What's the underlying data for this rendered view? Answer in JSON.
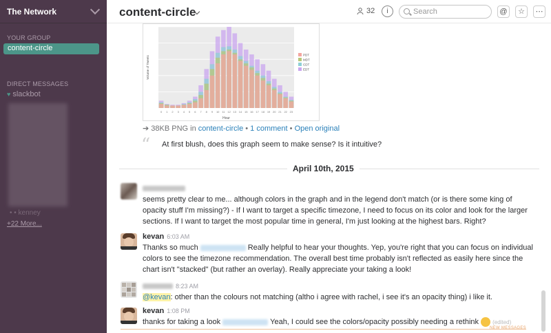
{
  "sidebar": {
    "team_name": "The Network",
    "your_group_title": "YOUR GROUP",
    "active_channel": "content-circle",
    "dm_title": "DIRECT MESSAGES",
    "slackbot": "slackbot",
    "ghost_name": "• • kenney",
    "more_link": "+22 More..."
  },
  "header": {
    "channel_title": "content-circle",
    "member_count": "32",
    "search_placeholder": "Search",
    "info_label": "i",
    "at_label": "@",
    "star_label": "☆",
    "more_label": "⋯"
  },
  "file": {
    "size_type": "38KB PNG in ",
    "channel": "content-circle",
    "comments": "1 comment",
    "open": "Open original",
    "sep": " • "
  },
  "quote_text": "At first blush, does this graph seem to make sense? Is it intuitive?",
  "day_label": "April 10th, 2015",
  "messages": {
    "m1_text": "seems pretty clear to me... although colors in the graph and in the legend don't match (or is there some king of opacity stuff I'm missing?) - If I want to target a specific timezone, I need to focus on its color and look for the larger sections. If I want to target the most popular time in general, I'm just looking at the highest bars. Right?",
    "m2_author": "kevan",
    "m2_time": "6:03 AM",
    "m2_pre": "Thanks so much",
    "m2_post": "Really helpful to hear your thoughts. Yep, you're right that you can focus on individual colors to see the timezone recommendation. The overall best time probably isn't reflected as easily here since the chart isn't \"stacked\" (but rather an overlay). Really appreciate your taking a look!",
    "m3_time": "8:23 AM",
    "m3_mention": "@kevan",
    "m3_text": ": other than the colours not matching (altho i agree with rachel, i see it's an opacity thing) i like it.",
    "m4_author": "kevan",
    "m4_time": "1:08 PM",
    "m4_pre": "thanks for taking a look",
    "m4_post": "Yeah, I could see the colors/opacity possibly needing a rethink",
    "m4_edited": "(edited)",
    "new_messages": "NEW MESSAGES"
  },
  "chart_data": {
    "type": "bar",
    "title": "",
    "xlabel": "Hour",
    "ylabel": "Volume of Tweets",
    "categories": [
      "0",
      "1",
      "2",
      "3",
      "4",
      "5",
      "6",
      "7",
      "8",
      "9",
      "10",
      "11",
      "12",
      "13",
      "14",
      "15",
      "16",
      "17",
      "18",
      "19",
      "20",
      "21",
      "22",
      "23"
    ],
    "series": [
      {
        "name": "PDT",
        "color": "#f4a6a0",
        "values": [
          5,
          3,
          3,
          3,
          4,
          5,
          7,
          12,
          22,
          40,
          55,
          66,
          70,
          66,
          58,
          52,
          47,
          40,
          34,
          28,
          22,
          17,
          12,
          8
        ]
      },
      {
        "name": "MDT",
        "color": "#b7c77a",
        "values": [
          6,
          4,
          3,
          3,
          4,
          6,
          9,
          16,
          30,
          48,
          62,
          70,
          72,
          68,
          60,
          55,
          50,
          43,
          37,
          30,
          24,
          18,
          13,
          9
        ]
      },
      {
        "name": "CDT",
        "color": "#8fd0d6",
        "values": [
          7,
          4,
          3,
          3,
          5,
          7,
          11,
          20,
          36,
          54,
          68,
          75,
          76,
          72,
          64,
          58,
          52,
          46,
          40,
          33,
          26,
          20,
          14,
          10
        ]
      },
      {
        "name": "EDT",
        "color": "#c9a6ef",
        "values": [
          9,
          5,
          4,
          4,
          6,
          9,
          14,
          28,
          48,
          70,
          88,
          96,
          100,
          92,
          80,
          72,
          66,
          60,
          54,
          46,
          36,
          28,
          20,
          14
        ]
      }
    ],
    "ylim": [
      0,
      100
    ],
    "legend": "right",
    "grid": true
  }
}
